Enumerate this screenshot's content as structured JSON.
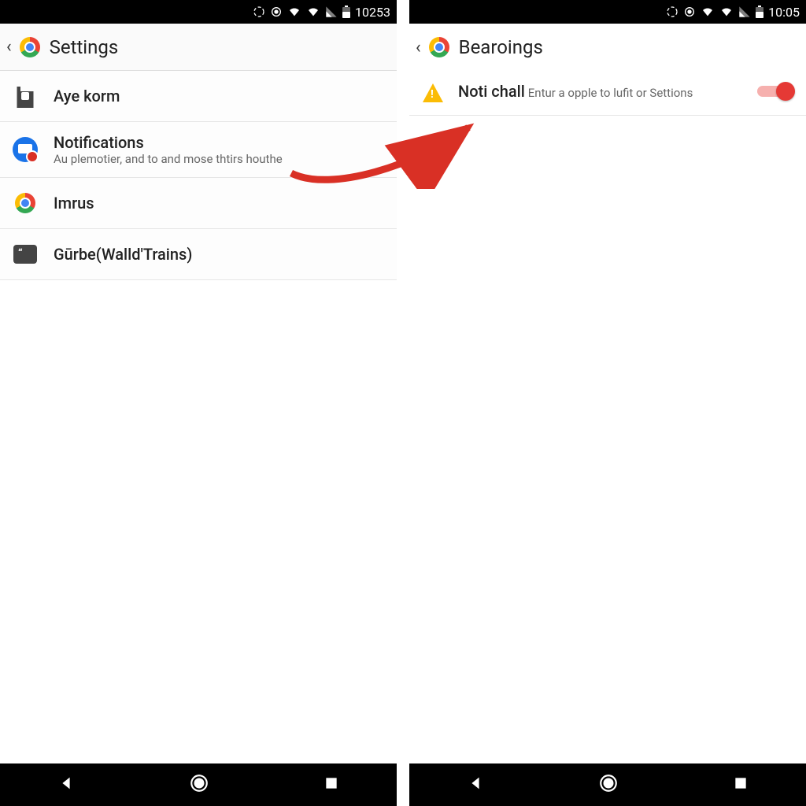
{
  "left": {
    "status_time": "10253",
    "title": "Settings",
    "items": [
      {
        "icon": "shop",
        "title": "Aye korm",
        "sub": ""
      },
      {
        "icon": "notif",
        "title": "Notifications",
        "sub": "Au plemotier, and to and mose thtirs houthe"
      },
      {
        "icon": "chrome",
        "title": "Imrus",
        "sub": ""
      },
      {
        "icon": "chat",
        "title": "Gūrbe(Walld'Trains)",
        "sub": ""
      }
    ]
  },
  "right": {
    "status_time": "10:05",
    "title": "Bearoings",
    "toggle": {
      "title": "Noti chall",
      "sub": "Entur a opple to lufit or Settions",
      "on": true
    }
  },
  "colors": {
    "accent": "#e53935",
    "arrow": "#d93025"
  }
}
